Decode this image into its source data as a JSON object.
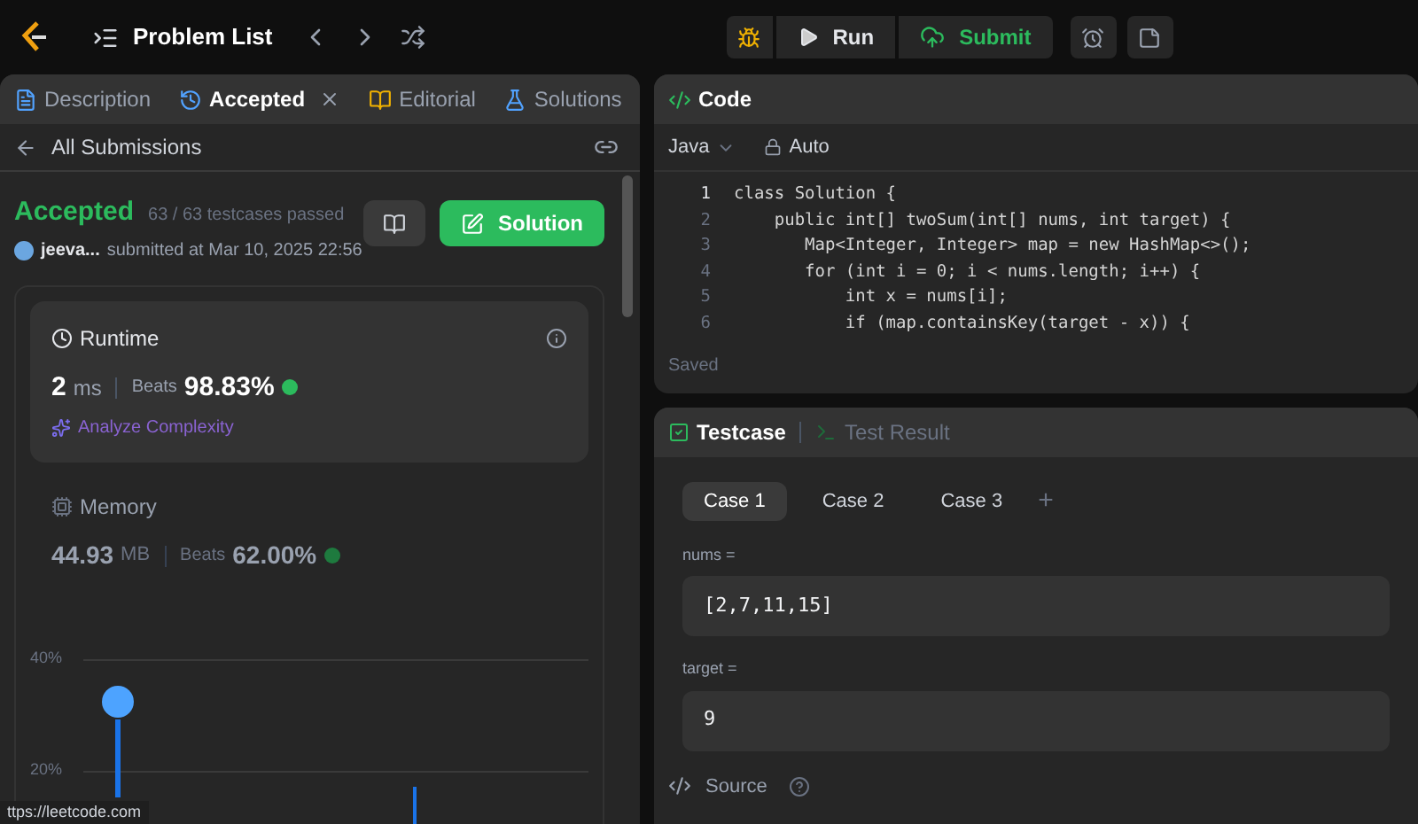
{
  "top_bar": {
    "title": "Problem List",
    "run": "Run",
    "submit": "Submit"
  },
  "left_tabs": [
    {
      "label": "Description",
      "selected": false,
      "closable": false
    },
    {
      "label": "Accepted",
      "selected": true,
      "closable": true
    },
    {
      "label": "Editorial",
      "selected": false,
      "closable": false
    },
    {
      "label": "Solutions",
      "selected": false,
      "closable": false
    }
  ],
  "back_link": "All Submissions",
  "submission": {
    "status": "Accepted",
    "passed": "63 / 63 testcases passed",
    "user": "jeeva...",
    "submitted": "submitted at Mar 10, 2025 22:56",
    "solution_button": "Solution"
  },
  "runtime": {
    "title": "Runtime",
    "value": "2",
    "unit": "ms",
    "beats_label": "Beats",
    "beats": "98.83%",
    "analyze": "Analyze Complexity"
  },
  "memory": {
    "title": "Memory",
    "value": "44.93",
    "unit": "MB",
    "beats_label": "Beats",
    "beats": "62.00%"
  },
  "distribution": {
    "y_labels": [
      "40%",
      "20%"
    ]
  },
  "status_url": "ttps://leetcode.com",
  "code_panel": {
    "title": "Code",
    "language": "Java",
    "mode": "Auto",
    "saved": "Saved",
    "lines": [
      {
        "number": "1",
        "text": "class Solution {"
      },
      {
        "number": "2",
        "text": "    public int[] twoSum(int[] nums, int target) {"
      },
      {
        "number": "3",
        "text": "       Map<Integer, Integer> map = new HashMap<>();"
      },
      {
        "number": "4",
        "text": "       for (int i = 0; i < nums.length; i++) {"
      },
      {
        "number": "5",
        "text": "           int x = nums[i];"
      },
      {
        "number": "6",
        "text": "           if (map.containsKey(target - x)) {"
      }
    ]
  },
  "test_panel": {
    "tabs": [
      {
        "label": "Testcase",
        "selected": true
      },
      {
        "label": "Test Result",
        "selected": false
      }
    ],
    "cases": [
      {
        "label": "Case 1",
        "selected": true
      },
      {
        "label": "Case 2",
        "selected": false
      },
      {
        "label": "Case 3",
        "selected": false
      }
    ],
    "add": "+",
    "inputs": [
      {
        "label": "nums =",
        "value": "[2,7,11,15]"
      },
      {
        "label": "target =",
        "value": "9"
      }
    ],
    "source": "Source"
  }
}
